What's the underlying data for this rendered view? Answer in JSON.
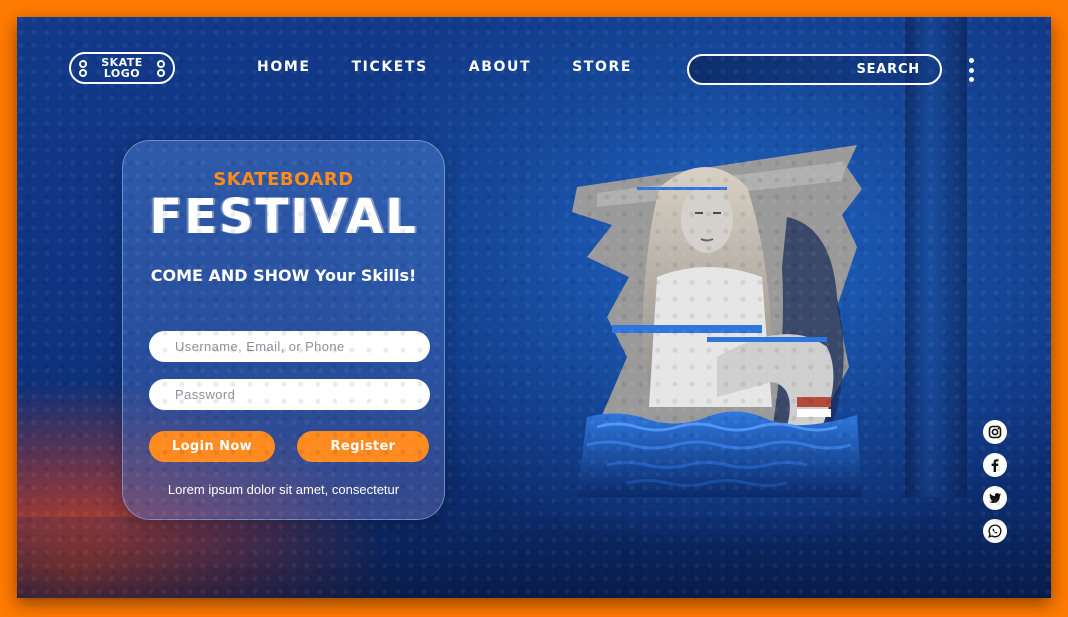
{
  "logo": {
    "text_line1": "SKATE",
    "text_line2": "LOGO"
  },
  "nav": {
    "items": [
      {
        "label": "HOME"
      },
      {
        "label": "TICKETS"
      },
      {
        "label": "ABOUT"
      },
      {
        "label": "STORE"
      }
    ]
  },
  "search": {
    "label": "SEARCH"
  },
  "menu": {
    "icon": "kebab-menu-icon"
  },
  "card": {
    "kicker": "SKATEBOARD",
    "headline": "FESTIVAL",
    "tagline": "COME AND SHOW Your Skills!",
    "username_placeholder": "Username, Email, or Phone",
    "password_placeholder": "Password",
    "login_label": "Login Now",
    "register_label": "Register",
    "footnote": "Lorem ipsum dolor sit amet, consectetur"
  },
  "social": [
    {
      "icon": "instagram-icon"
    },
    {
      "icon": "facebook-icon"
    },
    {
      "icon": "twitter-icon"
    },
    {
      "icon": "whatsapp-icon"
    }
  ],
  "colors": {
    "accent": "#ff8a1f",
    "border": "#ff7a00",
    "background": "#12398a"
  }
}
